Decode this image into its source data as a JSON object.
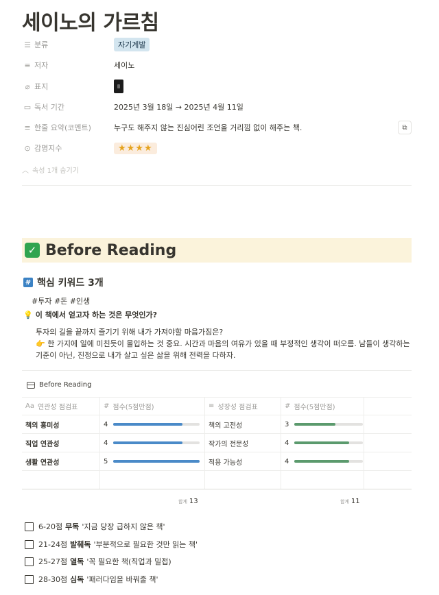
{
  "page": {
    "title": "세이노의 가르침"
  },
  "properties": {
    "category": {
      "label": "분류",
      "value": "자기계발"
    },
    "author": {
      "label": "저자",
      "value": "세이노"
    },
    "cover": {
      "label": "표지"
    },
    "period": {
      "label": "독서 기간",
      "value": "2025년 3월 18일 → 2025년 4월 11일"
    },
    "summary": {
      "label": "한줄 요약(코멘트)",
      "value": "누구도 해주지 않는 진심어린 조언을 거리낌 없이 해주는 책."
    },
    "rating": {
      "label": "감명지수",
      "value": "★★★★",
      "stars": 4
    },
    "hide_toggle": "속성 1개 숨기기"
  },
  "before_reading": {
    "title": "Before Reading",
    "keywords_heading": "핵심 키워드 3개",
    "keywords": "#투자 #돈 #인생",
    "question": "이 책에서 얻고자 하는 것은 무엇인가?",
    "answer_line1": "투자의 길을 끝까지 즐기기 위해 내가 가져야할 마음가짐은?",
    "answer_line2": "👉 한 가지에 일에 미친듯이 몰입하는 것 중요. 시간과 마음의 여유가 있을 때 부정적인 생각이 떠오름. 남들이 생각하는 기준이 아닌, 진정으로 내가 살고 싶은 삶을 위해 전력을 다하자."
  },
  "database": {
    "title": "Before Reading",
    "columns": {
      "col1": {
        "icon": "Aa",
        "label": "연관성 점검표"
      },
      "col2": {
        "icon": "#",
        "label": "점수(5점만점)"
      },
      "col3": {
        "icon": "≡",
        "label": "성장성 점검표"
      },
      "col4": {
        "icon": "#",
        "label": "점수(5점만점)"
      }
    },
    "rows": [
      {
        "item1": "책의 흥미성",
        "score1": "4",
        "item2": "책의 고전성",
        "score2": "3"
      },
      {
        "item1": "직업 연관성",
        "score1": "4",
        "item2": "작가의 전문성",
        "score2": "4"
      },
      {
        "item1": "생활 연관성",
        "score1": "5",
        "item2": "적용 가능성",
        "score2": "4"
      }
    ],
    "sum_label": "합계",
    "sum1": "13",
    "sum2": "11",
    "colors": {
      "bar1": "#4a8ac8",
      "bar2": "#5b9a6d"
    }
  },
  "todos": [
    {
      "range": "6-20점",
      "grade": "무독",
      "desc": "'지금 당장 급하지 않은 책'"
    },
    {
      "range": "21-24점",
      "grade": "발췌독",
      "desc": "'부분적으로 필요한 것만 읽는 책'"
    },
    {
      "range": "25-27점",
      "grade": "열독",
      "desc": "'꼭 필요한 책(직업과 밀접)"
    },
    {
      "range": "28-30점",
      "grade": "심독",
      "desc": "'패러다임을 바꿔줄 책'"
    }
  ]
}
